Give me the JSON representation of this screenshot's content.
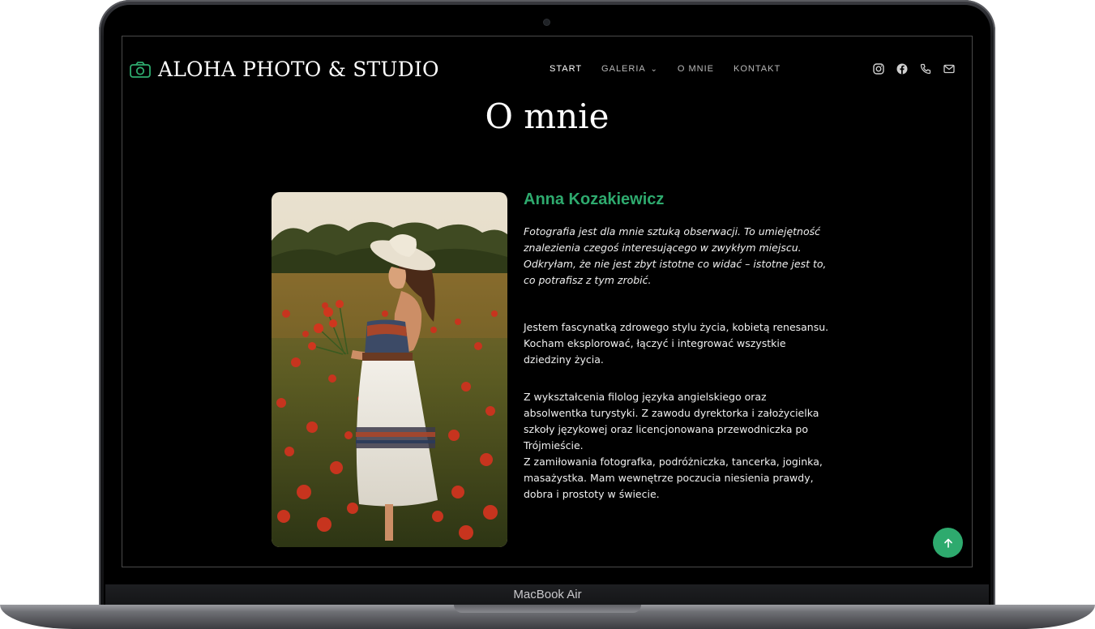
{
  "device": {
    "label": "MacBook Air"
  },
  "header": {
    "logo_text": "ALOHA PHOTO & STUDIO",
    "logo_icon": "camera-icon",
    "nav": [
      {
        "label": "START",
        "active": true
      },
      {
        "label": "GALERIA",
        "has_dropdown": true
      },
      {
        "label": "O MNIE"
      },
      {
        "label": "KONTAKT"
      }
    ],
    "social_icons": [
      "instagram-icon",
      "facebook-icon",
      "phone-icon",
      "mail-icon"
    ]
  },
  "main": {
    "title": "O mnie",
    "name": "Anna Kozakiewicz",
    "quote": "Fotografia jest dla mnie sztuką obserwacji. To umiejętność znalezienia czegoś interesującego w zwykłym miejscu. Odkryłam, że nie jest zbyt istotne co widać – istotne jest to, co potrafisz z tym zrobić.",
    "paragraph_1": "Jestem fascynatką zdrowego stylu życia, kobietą renesansu. Kocham eksplorować, łączyć i integrować wszystkie dziedziny życia.",
    "paragraph_2": "Z wykształcenia filolog języka angielskiego oraz absolwentka turystyki. Z zawodu dyrektorka i założycielka szkoły językowej oraz licencjonowana przewodniczka po Trójmieście.",
    "paragraph_3": "Z zamiłowania fotografka, podróżniczka, tancerka, joginka, masażystka. Mam wewnętrze poczucia niesienia prawdy, dobra i prostoty w świecie."
  },
  "colors": {
    "accent": "#2eaa6e",
    "background": "#000000",
    "text": "#f0f0f0"
  },
  "scroll_top_icon": "arrow-up-icon"
}
